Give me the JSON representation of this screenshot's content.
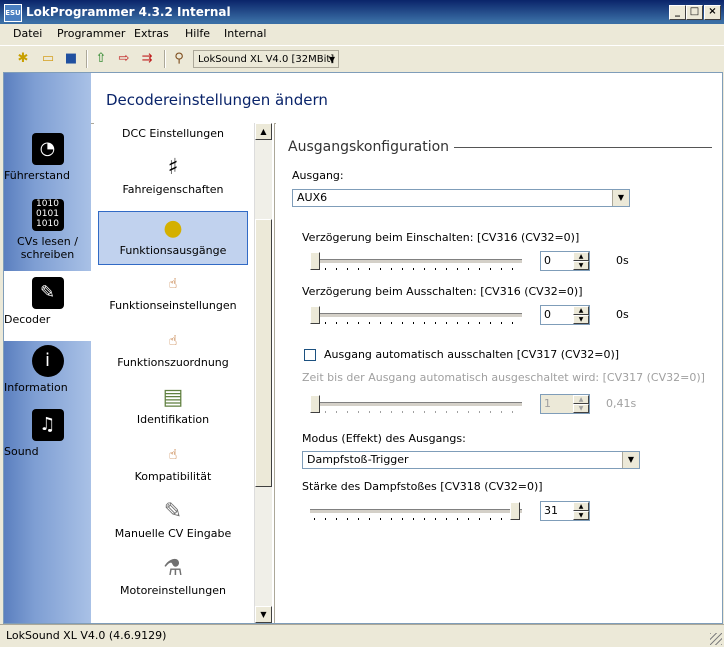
{
  "window": {
    "title": "LokProgrammer 4.3.2 Internal",
    "app_icon": "ESU"
  },
  "menu": [
    "Datei",
    "Programmer",
    "Extras",
    "Hilfe",
    "Internal"
  ],
  "toolbar": {
    "device": "LokSound XL V4.0 [32MBit]"
  },
  "nav": [
    {
      "label": "Führerstand",
      "icon": "cab-icon"
    },
    {
      "label": "CVs lesen / schreiben",
      "icon": "binary-icon"
    },
    {
      "label": "Decoder",
      "icon": "wrench-icon"
    },
    {
      "label": "Information",
      "icon": "info-icon"
    },
    {
      "label": "Sound",
      "icon": "music-icon"
    }
  ],
  "header": {
    "title": "Decodereinstellungen ändern"
  },
  "categories": [
    "DCC Einstellungen",
    "Fahreigenschaften",
    "Funktionsausgänge",
    "Funktionseinstellungen",
    "Funktionszuordnung",
    "Identifikation",
    "Kompatibilität",
    "Manuelle CV Eingabe",
    "Motoreinstellungen"
  ],
  "config": {
    "section": "Ausgangskonfiguration",
    "output_label": "Ausgang:",
    "output_value": "AUX6",
    "delay_on_label": "Verzögerung beim Einschalten: [CV316 (CV32=0)]",
    "delay_on_value": "0",
    "delay_on_unit": "0s",
    "delay_off_label": "Verzögerung beim Ausschalten: [CV316 (CV32=0)]",
    "delay_off_value": "0",
    "delay_off_unit": "0s",
    "auto_off_label": "Ausgang automatisch ausschalten [CV317 (CV32=0)]",
    "auto_off_time_label": "Zeit bis der Ausgang automatisch ausgeschaltet wird: [CV317 (CV32=0)]",
    "auto_off_value": "1",
    "auto_off_unit": "0,41s",
    "mode_label": "Modus (Effekt) des Ausgangs:",
    "mode_value": "Dampfstoß-Trigger",
    "strength_label": "Stärke des Dampfstoßes [CV318 (CV32=0)]",
    "strength_value": "31"
  },
  "status": {
    "text": "LokSound XL V4.0 (4.6.9129)"
  }
}
